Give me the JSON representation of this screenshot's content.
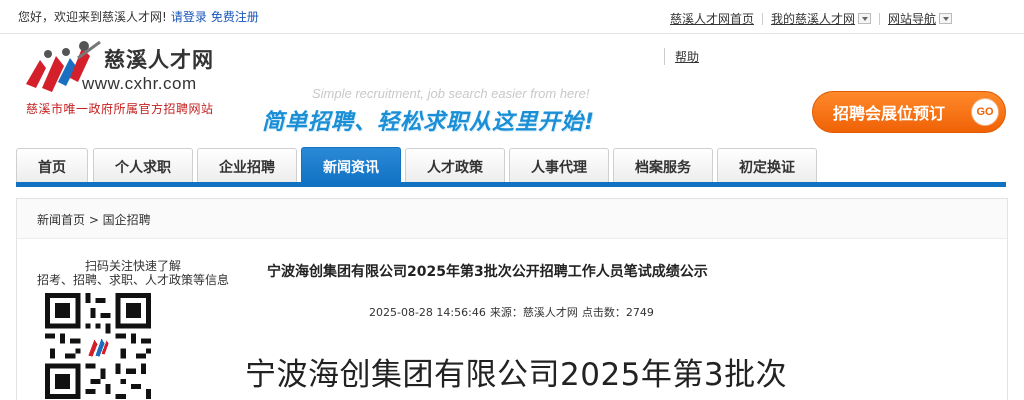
{
  "topbar": {
    "welcome": "您好，欢迎来到慈溪人才网!",
    "login": "请登录",
    "register": "免费注册",
    "links": [
      "慈溪人才网首页",
      "我的慈溪人才网",
      "网站导航"
    ]
  },
  "header": {
    "logo_cn": "慈溪人才网",
    "logo_url": "www.cxhr.com",
    "logo_tagline": "慈溪市唯一政府所属官方招聘网站",
    "help": "帮助",
    "slogan_en": "Simple recruitment, job search easier from here!",
    "slogan_cn": "简单招聘、轻松求职从这里开始!",
    "booth_button": "招聘会展位预订",
    "booth_go": "GO"
  },
  "nav": {
    "tabs": [
      "首页",
      "个人求职",
      "企业招聘",
      "新闻资讯",
      "人才政策",
      "人事代理",
      "档案服务",
      "初定换证"
    ],
    "active_index": 3
  },
  "breadcrumb": "新闻首页 > 国企招聘",
  "sidebar": {
    "qr_caption_line1": "扫码关注快速了解",
    "qr_caption_line2": "招考、招聘、求职、人才政策等信息"
  },
  "article": {
    "title": "宁波海创集团有限公司2025年第3批次公开招聘工作人员笔试成绩公示",
    "datetime": "2025-08-28 14:56:46",
    "source_label": "来源：",
    "source": "慈溪人才网",
    "clicks_label": "点击数：",
    "clicks": "2749",
    "body_heading": "宁波海创集团有限公司2025年第3批次"
  },
  "colors": {
    "brand_blue": "#1171c2",
    "accent_orange": "#f06206",
    "tagline_red": "#c42020",
    "link_blue": "#1a56b8"
  }
}
